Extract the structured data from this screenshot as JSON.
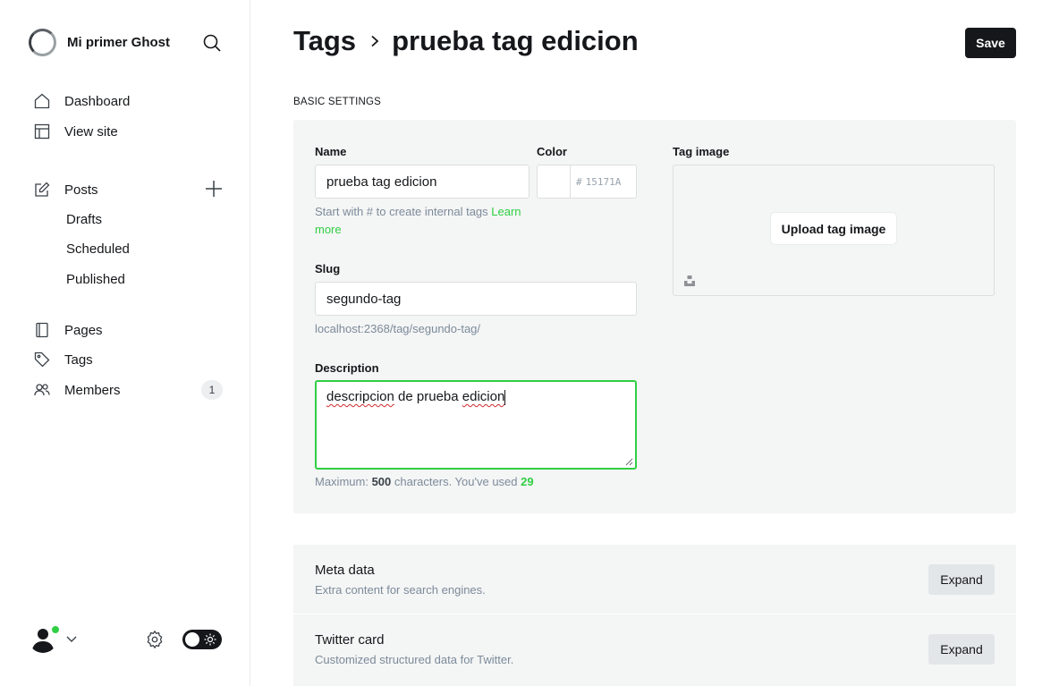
{
  "brand": {
    "name": "Mi primer Ghost"
  },
  "nav": {
    "dashboard": "Dashboard",
    "view_site": "View site",
    "posts": "Posts",
    "drafts": "Drafts",
    "scheduled": "Scheduled",
    "published": "Published",
    "pages": "Pages",
    "tags": "Tags",
    "members": "Members",
    "members_count": "1"
  },
  "header": {
    "breadcrumb_parent": "Tags",
    "breadcrumb_current": "prueba tag edicion",
    "save_label": "Save"
  },
  "basic": {
    "section_label": "BASIC SETTINGS",
    "name_label": "Name",
    "name_value": "prueba tag edicion",
    "name_hint": "Start with # to create internal tags",
    "name_hint_link": "Learn more",
    "color_label": "Color",
    "color_hash": "#",
    "color_value": "15171A",
    "slug_label": "Slug",
    "slug_value": "segundo-tag",
    "slug_url": "localhost:2368/tag/segundo-tag/",
    "description_label": "Description",
    "description_word1": "descripcion",
    "description_word2": " de prueba ",
    "description_word3": "edicion",
    "counter_prefix": "Maximum: ",
    "counter_max": "500",
    "counter_middle": " characters. You've used ",
    "counter_used": "29",
    "tag_image_label": "Tag image",
    "upload_label": "Upload tag image"
  },
  "cards": [
    {
      "title": "Meta data",
      "desc": "Extra content for search engines.",
      "button": "Expand"
    },
    {
      "title": "Twitter card",
      "desc": "Customized structured data for Twitter.",
      "button": "Expand"
    }
  ],
  "colors": {
    "accent_green": "#30cf43",
    "dark": "#15171a",
    "panel_bg": "#f4f5f5"
  }
}
